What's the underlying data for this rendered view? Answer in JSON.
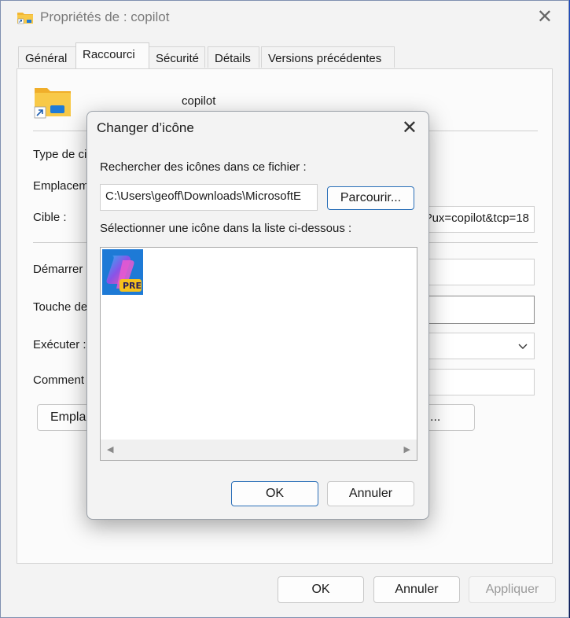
{
  "window": {
    "title": "Propriétés de : copilot",
    "tabs": [
      "Général",
      "Raccourci",
      "Sécurité",
      "Détails",
      "Versions précédentes"
    ],
    "active_tab": "Raccourci"
  },
  "shortcut_tab": {
    "name": "copilot",
    "labels": {
      "type": "Type de ci",
      "location": "Emplacem",
      "target": "Cible :",
      "start_in": "Démarrer",
      "shortcut_key": "Touche de",
      "run": "Exécuter :",
      "comment": "Comment"
    },
    "target_value": "?ux=copilot&tcp=18",
    "open_location_button": "Emplac",
    "change_icon_button_fragment": "..."
  },
  "footer": {
    "ok": "OK",
    "cancel": "Annuler",
    "apply": "Appliquer"
  },
  "change_icon_dialog": {
    "title": "Changer d’icône",
    "search_label": "Rechercher des icônes dans ce fichier :",
    "file_path": "C:\\Users\\geoff\\Downloads\\MicrosoftE",
    "browse_button": "Parcourir...",
    "list_label": "Sélectionner une icône dans la liste ci-dessous :",
    "icons": [
      {
        "name": "copilot-pre-icon",
        "badge": "PRE"
      }
    ],
    "ok": "OK",
    "cancel": "Annuler"
  }
}
